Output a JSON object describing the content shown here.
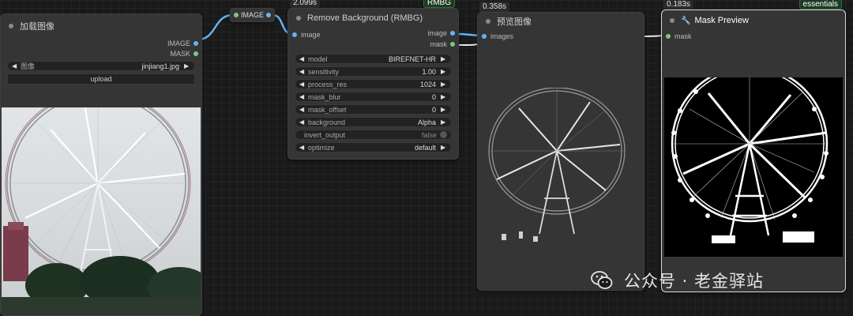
{
  "load_node": {
    "title": "加载图像",
    "outputs": [
      "IMAGE",
      "MASK"
    ],
    "image_widget": {
      "label": "图像",
      "value": "jinjiang1.jpg"
    },
    "upload_label": "upload"
  },
  "reroute_node": {
    "label": "IMAGE"
  },
  "rmbg_node": {
    "time": "2.099s",
    "tag": "RMBG",
    "title": "Remove Background (RMBG)",
    "input": "image",
    "outputs": [
      "image",
      "mask"
    ],
    "widgets": [
      {
        "label": "model",
        "value": "BIREFNET-HR"
      },
      {
        "label": "sensitivity",
        "value": "1.00"
      },
      {
        "label": "process_res",
        "value": "1024"
      },
      {
        "label": "mask_blur",
        "value": "0"
      },
      {
        "label": "mask_offset",
        "value": "0"
      },
      {
        "label": "background",
        "value": "Alpha"
      }
    ],
    "toggle": {
      "label": "invert_output",
      "value": "false"
    },
    "optimize": {
      "label": "optimize",
      "value": "default"
    }
  },
  "preview_node": {
    "time": "0.358s",
    "title": "预览图像",
    "input": "images"
  },
  "mask_node": {
    "time": "0.183s",
    "tag": "essentials",
    "title": "Mask Preview",
    "input": "mask"
  },
  "watermark": {
    "text": "公众号 · 老金驿站"
  },
  "colors": {
    "image_port": "#64b5f6",
    "mask_port": "#81c784",
    "node_bg": "#353535",
    "canvas_bg": "#1a1a1a"
  }
}
